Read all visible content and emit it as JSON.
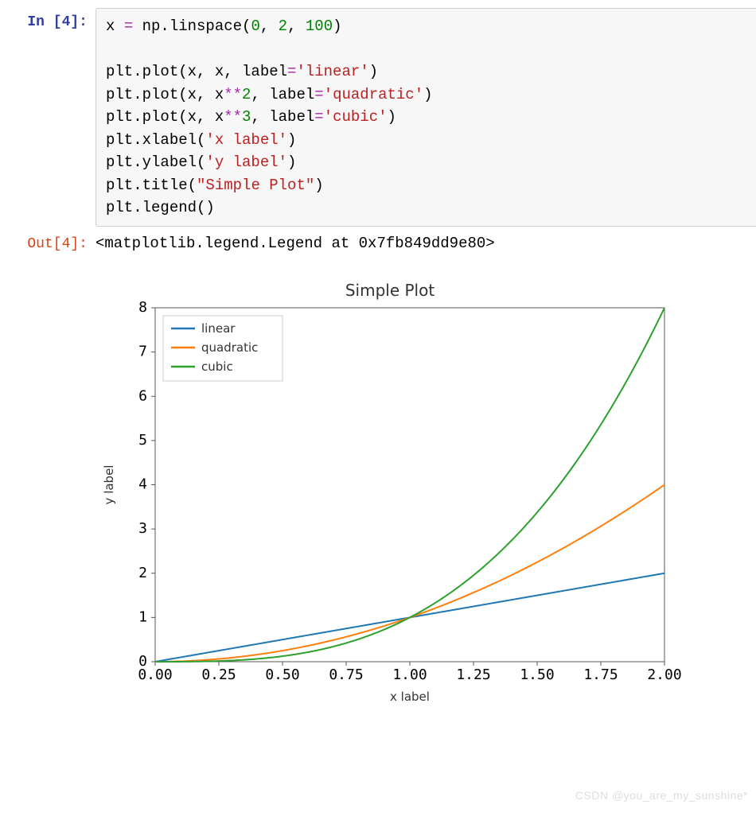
{
  "prompts": {
    "in": "In [4]:",
    "out": "Out[4]:"
  },
  "code": {
    "l1a": "x ",
    "l1op": "=",
    "l1b": " np.linspace(",
    "l1n1": "0",
    "l1c": ", ",
    "l1n2": "2",
    "l1d": ", ",
    "l1n3": "100",
    "l1e": ")",
    "blank": "",
    "l2a": "plt.plot(x, x, label",
    "l2eq": "=",
    "l2s": "'linear'",
    "l2b": ")",
    "l3a": "plt.plot(x, x",
    "l3op": "**",
    "l3n": "2",
    "l3b": ", label",
    "l3eq": "=",
    "l3s": "'quadratic'",
    "l3c": ")",
    "l4a": "plt.plot(x, x",
    "l4op": "**",
    "l4n": "3",
    "l4b": ", label",
    "l4eq": "=",
    "l4s": "'cubic'",
    "l4c": ")",
    "l5a": "plt.xlabel(",
    "l5s": "'x label'",
    "l5b": ")",
    "l6a": "plt.ylabel(",
    "l6s": "'y label'",
    "l6b": ")",
    "l7a": "plt.title(",
    "l7s": "\"Simple Plot\"",
    "l7b": ")",
    "l8": "plt.legend()"
  },
  "output_text": "<matplotlib.legend.Legend at 0x7fb849dd9e80>",
  "watermark": "CSDN @you_are_my_sunshine*",
  "chart_data": {
    "type": "line",
    "title": "Simple Plot",
    "xlabel": "x label",
    "ylabel": "y label",
    "xlim": [
      0,
      2
    ],
    "ylim": [
      0,
      8
    ],
    "xticks": [
      0.0,
      0.25,
      0.5,
      0.75,
      1.0,
      1.25,
      1.5,
      1.75,
      2.0
    ],
    "yticks": [
      0,
      1,
      2,
      3,
      4,
      5,
      6,
      7,
      8
    ],
    "xtick_labels": [
      "0.00",
      "0.25",
      "0.50",
      "0.75",
      "1.00",
      "1.25",
      "1.50",
      "1.75",
      "2.00"
    ],
    "ytick_labels": [
      "0",
      "1",
      "2",
      "3",
      "4",
      "5",
      "6",
      "7",
      "8"
    ],
    "series": [
      {
        "name": "linear",
        "color": "#1f77b4",
        "fn": "x"
      },
      {
        "name": "quadratic",
        "color": "#ff7f0e",
        "fn": "x*x"
      },
      {
        "name": "cubic",
        "color": "#2ca02c",
        "fn": "x*x*x"
      }
    ],
    "legend_pos": "upper-left"
  }
}
